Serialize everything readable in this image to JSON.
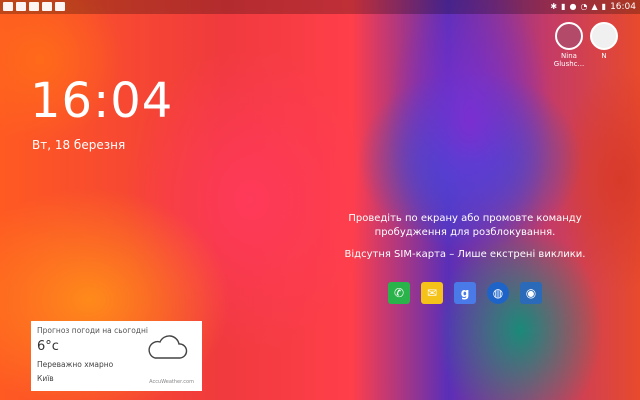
{
  "clock": {
    "time": "16:04",
    "date": "Вт, 18 березня"
  },
  "statusbar": {
    "time": "16:04",
    "battery_icon": "battery-icon",
    "wifi_icon": "wifi-icon"
  },
  "users": [
    {
      "name": "Nina\nGlushc...",
      "avatar_color": "#b34a6a"
    },
    {
      "name": "N",
      "avatar_color": "#f0f0f0"
    }
  ],
  "unlock_hint": "Проведіть по екрану або промовте команду пробудження для розблокування.",
  "sim_status": "Відсутня SIM-карта – Лише екстрені виклики.",
  "shortcuts": [
    {
      "name": "phone-icon",
      "color": "#2ab34a"
    },
    {
      "name": "email-icon",
      "color": "#f5c21a"
    },
    {
      "name": "google-icon",
      "color": "#4a7ae8"
    },
    {
      "name": "internet-icon",
      "color": "#1e64c8"
    },
    {
      "name": "camera-icon",
      "color": "#2a6ab8"
    }
  ],
  "weather": {
    "title": "Прогноз погоди на сьогодні",
    "temperature": "6°c",
    "condition": "Переважно хмарно",
    "city": "Київ",
    "brand": "AccuWeather.com"
  }
}
